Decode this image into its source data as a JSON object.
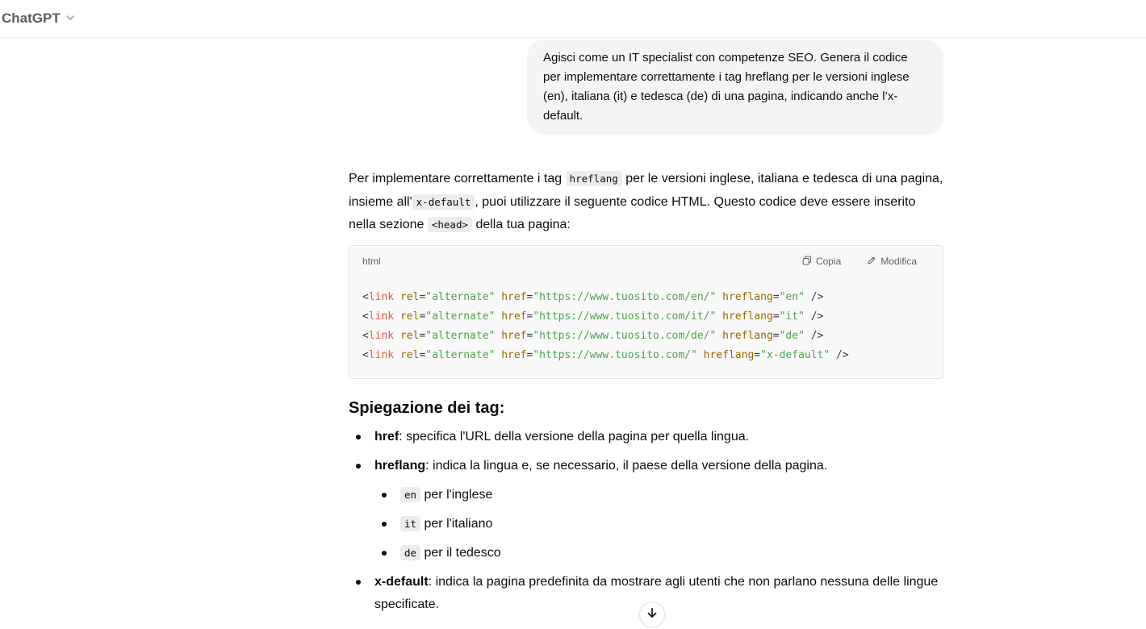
{
  "header": {
    "model_label": "ChatGPT"
  },
  "user_message": "Agisci come un IT specialist con competenze SEO. Genera il codice per implementare correttamente i tag hreflang per le versioni inglese (en), italiana (it) e tedesca (de) di una pagina, indicando anche l’x-default.",
  "answer": {
    "intro": {
      "p1": "Per implementare correttamente i tag ",
      "code1": "hreflang",
      "p2": " per le versioni inglese, italiana e tedesca di una pagina, insieme all'",
      "code2": "x-default",
      "p3": ", puoi utilizzare il seguente codice HTML. Questo codice deve essere inserito nella sezione ",
      "code3": "<head>",
      "p4": " della tua pagina:"
    },
    "codeblock": {
      "language": "html",
      "copy_label": "Copia",
      "edit_label": "Modifica",
      "lines": [
        {
          "url": "\"https://www.tuosito.com/en/\"",
          "lang": "\"en\""
        },
        {
          "url": "\"https://www.tuosito.com/it/\"",
          "lang": "\"it\""
        },
        {
          "url": "\"https://www.tuosito.com/de/\"",
          "lang": "\"de\""
        },
        {
          "url": "\"https://www.tuosito.com/\"",
          "lang": "\"x-default\""
        }
      ],
      "tokens": {
        "open": "<",
        "tag": "link",
        "rel_attr": "rel",
        "rel_val": "\"alternate\"",
        "href_attr": "href",
        "hreflang_attr": "hreflang",
        "eq": "=",
        "close": "/>"
      }
    },
    "section_title": "Spiegazione dei tag:",
    "bullets": {
      "href": {
        "term": "href",
        "text": ": specifica l'URL della versione della pagina per quella lingua."
      },
      "hreflang": {
        "term": "hreflang",
        "text": ": indica la lingua e, se necessario, il paese della versione della pagina.",
        "sub": [
          {
            "code": "en",
            "text": " per l'inglese"
          },
          {
            "code": "it",
            "text": " per l'italiano"
          },
          {
            "code": "de",
            "text": " per il tedesco"
          }
        ]
      },
      "xdefault": {
        "term": "x-default",
        "text": ": indica la pagina predefinita da mostrare agli utenti che non parlano nessuna delle lingue specificate."
      }
    }
  },
  "icons": {
    "model_dropdown": "chevron-down-icon",
    "copy": "copy-icon",
    "edit": "pencil-icon",
    "scroll_down": "arrow-down-icon"
  }
}
